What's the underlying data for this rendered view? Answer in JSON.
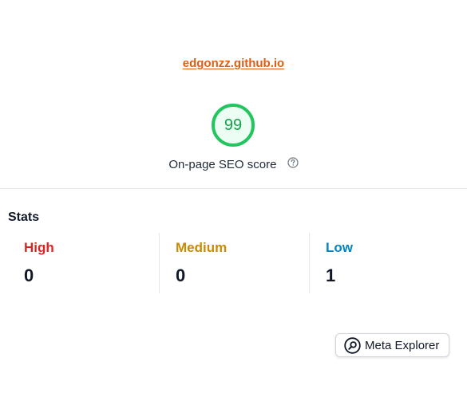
{
  "header": {
    "site_url": "edgonzz.github.io"
  },
  "score": {
    "value": "99",
    "value_fraction": 0.99,
    "label": "On-page SEO score",
    "help_icon": "question-circle-icon",
    "color": "#22c55e"
  },
  "stats": {
    "title": "Stats",
    "items": [
      {
        "label": "High",
        "value": "0",
        "color": "#dc2626"
      },
      {
        "label": "Medium",
        "value": "0",
        "color": "#ca8a04"
      },
      {
        "label": "Low",
        "value": "1",
        "color": "#0284c7"
      }
    ]
  },
  "footer": {
    "button_label": "Meta Explorer",
    "button_icon": "search-icon"
  },
  "colors": {
    "link": "#e05d13",
    "divider": "#e5e7eb"
  }
}
